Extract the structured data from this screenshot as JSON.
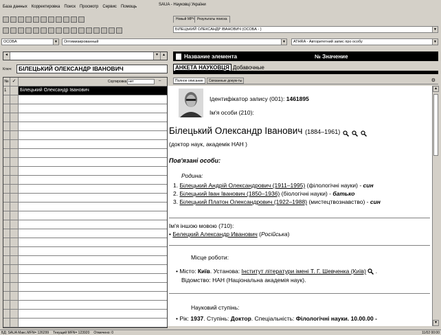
{
  "menu": {
    "items": [
      "База данных",
      "Корректировка",
      "Поиск",
      "Просмотр",
      "Сервис",
      "Помощь"
    ]
  },
  "app_title": "SAUA - Науковці України",
  "search_tabs": [
    "Новый МРЧ",
    "Результаты поиска"
  ],
  "search_result_field": "БІЛЕЦЬКИЙ ОЛЕКСАНДР ІВАНОВИЧ (ОСОБА - )",
  "record_type_combo": "ОСОБА",
  "mode_combo": "Оптимизированный",
  "format_combo": "ATHRA - Авторитетний запис про особу",
  "key_label": "Ключ:",
  "key_value": "БІЛЕЦЬКИЙ ОЛЕКСАНДР ІВАНОВИЧ",
  "list": {
    "col_num": "№",
    "col_check": "✓",
    "sort_label": "Сортировка",
    "sort_value": "нет",
    "items": [
      {
        "num": "1",
        "text": "Білецький Олександр Іванович"
      }
    ]
  },
  "right_header": {
    "name_col": "Название элемента",
    "value_col": "№ Значение"
  },
  "right_tabs": [
    "АНКЕТА НАУКОВЦЯ",
    "Добавочные"
  ],
  "doc_tabs": [
    "Полное описание",
    "Связанные докум-ты"
  ],
  "doc": {
    "record_id_label": "Ідентифікатор запису (001):",
    "record_id_value": "1461895",
    "person_name_label": "Ім'я особи (210):",
    "person_name": "Білецький Олександр Іванович",
    "person_years": "(1884–1961)",
    "person_title": "(доктор наук, академік НАН )",
    "related_heading": "Пов'язані особи:",
    "family_heading": "Родина:",
    "relatives": [
      {
        "num": "1.",
        "name": "Білецький Андрій Олександрович (1911–1995)",
        "field": "(філологічні науки)",
        "rel": "син"
      },
      {
        "num": "2.",
        "name": "Білецький Іван Іванович (1850–1936)",
        "field": "(біологічні науки)",
        "rel": "батько"
      },
      {
        "num": "3.",
        "name": "Білецький Платон Олександрович (1922–1988)",
        "field": "(мистецтвознавство)",
        "rel": "син"
      }
    ],
    "other_lang_label": "Ім'я іншою мовою (710):",
    "other_lang_name": "Белецкий Александр Иванович",
    "other_lang_lang": "Російська",
    "work_heading": "Місце роботи:",
    "work_city_label": "Місто:",
    "work_city": "Київ",
    "work_inst_label": "Установа:",
    "work_inst": "Інститут літератури імені Т. Г. Шевченка (Київ)",
    "work_dept_label": "Відомство:",
    "work_dept": "НАН (Національна академія наук).",
    "degree_heading": "Науковий ступінь:",
    "degree_year_label": "Рік:",
    "degree_year": "1937",
    "degree_label": "Ступінь:",
    "degree": "Доктор",
    "degree_spec_label": "Спеціальність:",
    "degree_spec": "Філологічні науки. 10.00.00 -"
  },
  "status": {
    "a": "БД: SAUA Макс.MFN= 126299",
    "b": "Текущий MFN= 123920",
    "c": "Отмечено: 0",
    "d": "11/02 00:00"
  }
}
